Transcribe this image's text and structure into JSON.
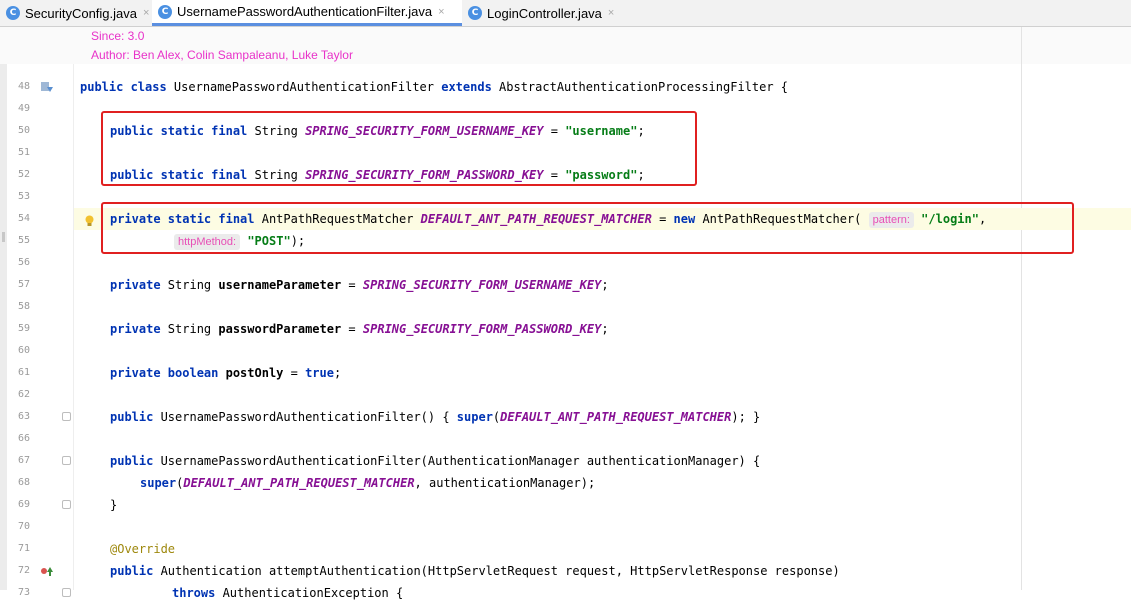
{
  "tabs": [
    {
      "label": "SecurityConfig.java",
      "icon": "class-icon",
      "icon_letter": "C",
      "active": false
    },
    {
      "label": "UsernamePasswordAuthenticationFilter.java",
      "icon": "class-icon",
      "icon_letter": "C",
      "active": true
    },
    {
      "label": "LoginController.java",
      "icon": "class-icon",
      "icon_letter": "C",
      "active": false
    }
  ],
  "tab_close_glyph": "×",
  "doc": {
    "since": "Since:  3.0",
    "author": "Author: Ben Alex, Colin Sampaleanu, Luke Taylor"
  },
  "colors": {
    "keyword": "#0033b3",
    "string": "#067d17",
    "constant": "#871094",
    "doc_text": "#e832c9",
    "highlight_box": "#e02020"
  },
  "lines": {
    "l48": {
      "num": "48",
      "t": [
        "public class ",
        "UsernamePasswordAuthenticationFilter ",
        "extends ",
        "AbstractAuthenticationProcessingFilter {"
      ]
    },
    "l49": {
      "num": "49"
    },
    "l50": {
      "num": "50",
      "t": [
        "public static final ",
        "String ",
        "SPRING_SECURITY_FORM_USERNAME_KEY",
        " = ",
        "\"username\"",
        ";"
      ]
    },
    "l51": {
      "num": "51"
    },
    "l52": {
      "num": "52",
      "t": [
        "public static final ",
        "String ",
        "SPRING_SECURITY_FORM_PASSWORD_KEY",
        " = ",
        "\"password\"",
        ";"
      ]
    },
    "l53": {
      "num": "53"
    },
    "l54": {
      "num": "54",
      "t": [
        "private static final ",
        "AntPathRequestMatcher ",
        "DEFAULT_ANT_PATH_REQUEST_MATCHER",
        " = ",
        "new ",
        "AntPathRequestMatcher( ",
        "pattern:",
        " ",
        "\"/login\"",
        ","
      ]
    },
    "l55": {
      "num": "55",
      "t": [
        "httpMethod:",
        " ",
        "\"POST\"",
        ");"
      ]
    },
    "l56": {
      "num": "56"
    },
    "l57": {
      "num": "57",
      "t": [
        "private ",
        "String ",
        "usernameParameter",
        " = ",
        "SPRING_SECURITY_FORM_USERNAME_KEY",
        ";"
      ]
    },
    "l58": {
      "num": "58"
    },
    "l59": {
      "num": "59",
      "t": [
        "private ",
        "String ",
        "passwordParameter",
        " = ",
        "SPRING_SECURITY_FORM_PASSWORD_KEY",
        ";"
      ]
    },
    "l60": {
      "num": "60"
    },
    "l61": {
      "num": "61",
      "t": [
        "private boolean ",
        "postOnly",
        " = ",
        "true",
        ";"
      ]
    },
    "l62": {
      "num": "62"
    },
    "l63": {
      "num": "63",
      "t": [
        "public ",
        "UsernamePasswordAuthenticationFilter() { ",
        "super",
        "(",
        "DEFAULT_ANT_PATH_REQUEST_MATCHER",
        "); }"
      ]
    },
    "l66": {
      "num": "66"
    },
    "l67": {
      "num": "67",
      "t": [
        "public ",
        "UsernamePasswordAuthenticationFilter(AuthenticationManager authenticationManager) {"
      ]
    },
    "l68": {
      "num": "68",
      "t": [
        "super",
        "(",
        "DEFAULT_ANT_PATH_REQUEST_MATCHER",
        ", authenticationManager);"
      ]
    },
    "l69": {
      "num": "69",
      "t": [
        "}"
      ]
    },
    "l70": {
      "num": "70"
    },
    "l71": {
      "num": "71",
      "t": [
        "@Override"
      ]
    },
    "l72": {
      "num": "72",
      "t": [
        "public ",
        "Authentication attemptAuthentication(HttpServletRequest request, HttpServletResponse response)"
      ]
    },
    "l73": {
      "num": "73",
      "t": [
        "throws ",
        "AuthenticationException {"
      ]
    }
  }
}
